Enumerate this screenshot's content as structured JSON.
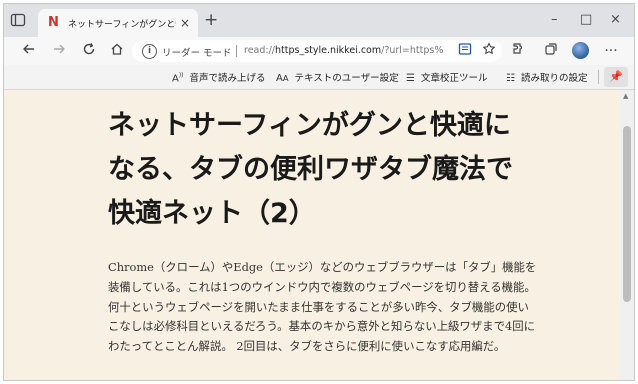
{
  "tab": {
    "favicon": "N",
    "title": "ネットサーフィンがグンと快適になる、タ",
    "close": "×",
    "new_tab": "+"
  },
  "window_controls": {
    "minimize": "–",
    "maximize": "□",
    "close": "×"
  },
  "address_bar": {
    "mode_label": "リーダー モード",
    "url_prefix": "read://",
    "url_host": "https_style.nikkei.com",
    "url_rest": "/?url=https%3A%2F%2Fst..."
  },
  "reader_toolbar": {
    "read_aloud": "音声で読み上げる",
    "text_prefs": "テキストのユーザー設定",
    "grammar_tools": "文章校正ツール",
    "reading_prefs": "読み取りの設定"
  },
  "article": {
    "title": "ネットサーフィンがグンと快適になる、タブの便利ワザタブ魔法で快適ネット（2）",
    "body": "Chrome（クローム）やEdge（エッジ）などのウェブブラウザーは「タブ」機能を装備している。これは1つのウインドウ内で複数のウェブページを切り替える機能。何十というウェブページを開いたまま仕事をすることが多い昨今、タブ機能の使いこなしは必修科目といえるだろう。基本のキから意外と知らない上級ワザまで4回にわたってとことん解説。 2回目は、タブをさらに便利に使いこなす応用編だ。"
  },
  "icons": {
    "tab_actions": "tab-actions-icon",
    "back": "back-arrow-icon",
    "forward": "forward-arrow-icon",
    "refresh": "refresh-icon",
    "home": "home-icon",
    "info": "info-icon",
    "reader_mode": "reader-mode-icon",
    "add_favorite": "add-favorite-icon",
    "extensions": "extensions-icon",
    "collections": "collections-icon",
    "profile": "profile-avatar",
    "more": "more-icon",
    "pin": "pin-icon"
  },
  "colors": {
    "reader_background": "#f8f1e3",
    "tab_strip": "#dfe1e5",
    "accent": "#1e5aa8"
  }
}
